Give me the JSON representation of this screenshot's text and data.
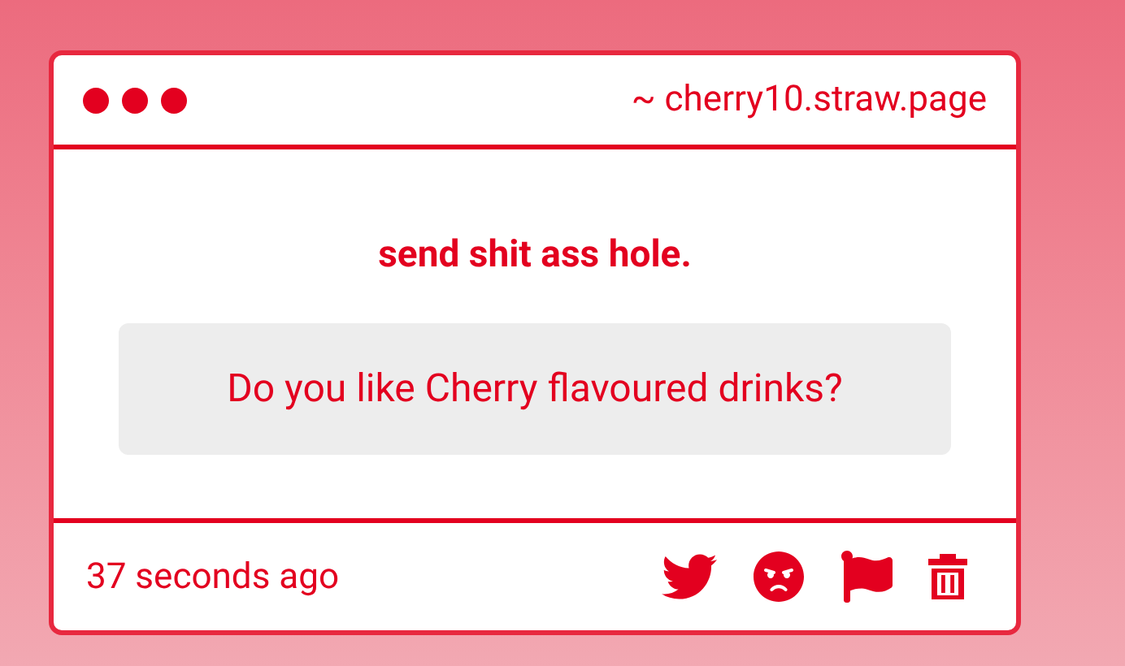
{
  "header": {
    "domain": "~ cherry10.straw.page"
  },
  "card": {
    "author": "send shit ass hole.",
    "message": "Do you like Cherry flavoured drinks?"
  },
  "footer": {
    "time": "37 seconds ago"
  }
}
